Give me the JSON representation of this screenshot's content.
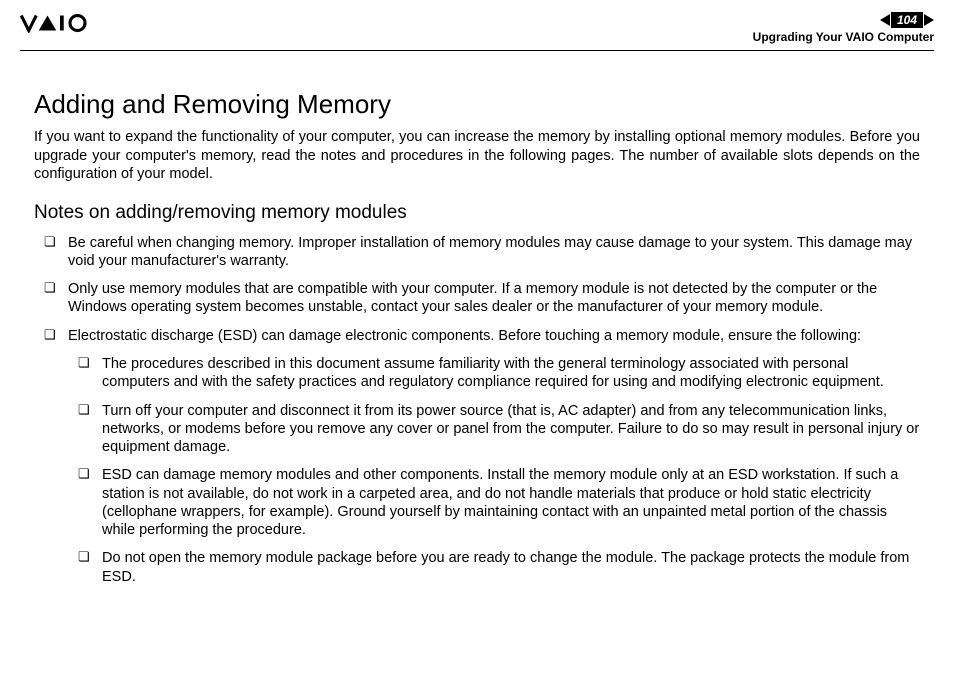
{
  "header": {
    "page_number": "104",
    "section_title": "Upgrading Your VAIO Computer"
  },
  "content": {
    "h1": "Adding and Removing Memory",
    "intro": "If you want to expand the functionality of your computer, you can increase the memory by installing optional memory modules. Before you upgrade your computer's memory, read the notes and procedures in the following pages. The number of available slots depends on the configuration of your model.",
    "h2": "Notes on adding/removing memory modules",
    "notes": [
      "Be careful when changing memory. Improper installation of memory modules may cause damage to your system. This damage may void your manufacturer's warranty.",
      "Only use memory modules that are compatible with your computer. If a memory module is not detected by the computer or the Windows operating system becomes unstable, contact your sales dealer or the manufacturer of your memory module.",
      "Electrostatic discharge (ESD) can damage electronic components. Before touching a memory module, ensure the following:"
    ],
    "sub_notes": [
      "The procedures described in this document assume familiarity with the general terminology associated with personal computers and with the safety practices and regulatory compliance required for using and modifying electronic equipment.",
      "Turn off your computer and disconnect it from its power source (that is, AC adapter) and from any telecommunication links, networks, or modems before you remove any cover or panel from the computer. Failure to do so may result in personal injury or equipment damage.",
      "ESD can damage memory modules and other components. Install the memory module only at an ESD workstation. If such a station is not available, do not work in a carpeted area, and do not handle materials that produce or hold static electricity (cellophane wrappers, for example). Ground yourself by maintaining contact with an unpainted metal portion of the chassis while performing the procedure.",
      "Do not open the memory module package before you are ready to change the module. The package protects the module from ESD."
    ]
  }
}
